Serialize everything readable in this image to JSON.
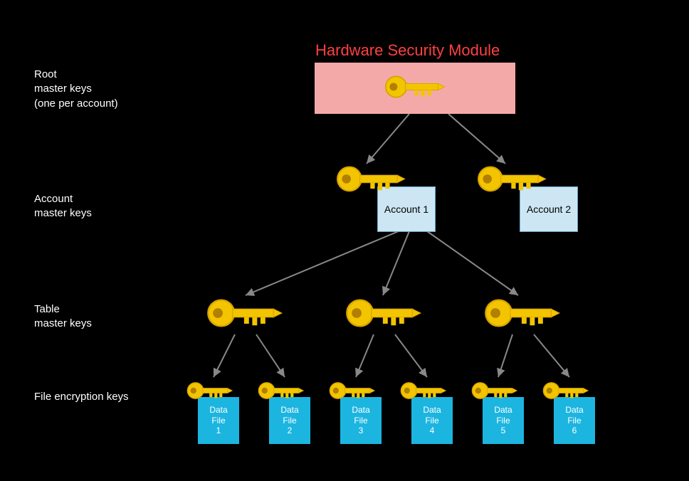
{
  "title": "Hardware Security Module",
  "side_labels": {
    "root": "Root\nmaster keys\n(one per account)",
    "account": "Account\nmaster keys",
    "table": "Table\nmaster keys",
    "file": "File encryption keys"
  },
  "accounts": [
    {
      "label": "Account 1"
    },
    {
      "label": "Account 2"
    }
  ],
  "datafiles": [
    {
      "label": "Data\nFile\n1"
    },
    {
      "label": "Data\nFile\n2"
    },
    {
      "label": "Data\nFile\n3"
    },
    {
      "label": "Data\nFile\n4"
    },
    {
      "label": "Data\nFile\n5"
    },
    {
      "label": "Data\nFile\n6"
    }
  ]
}
